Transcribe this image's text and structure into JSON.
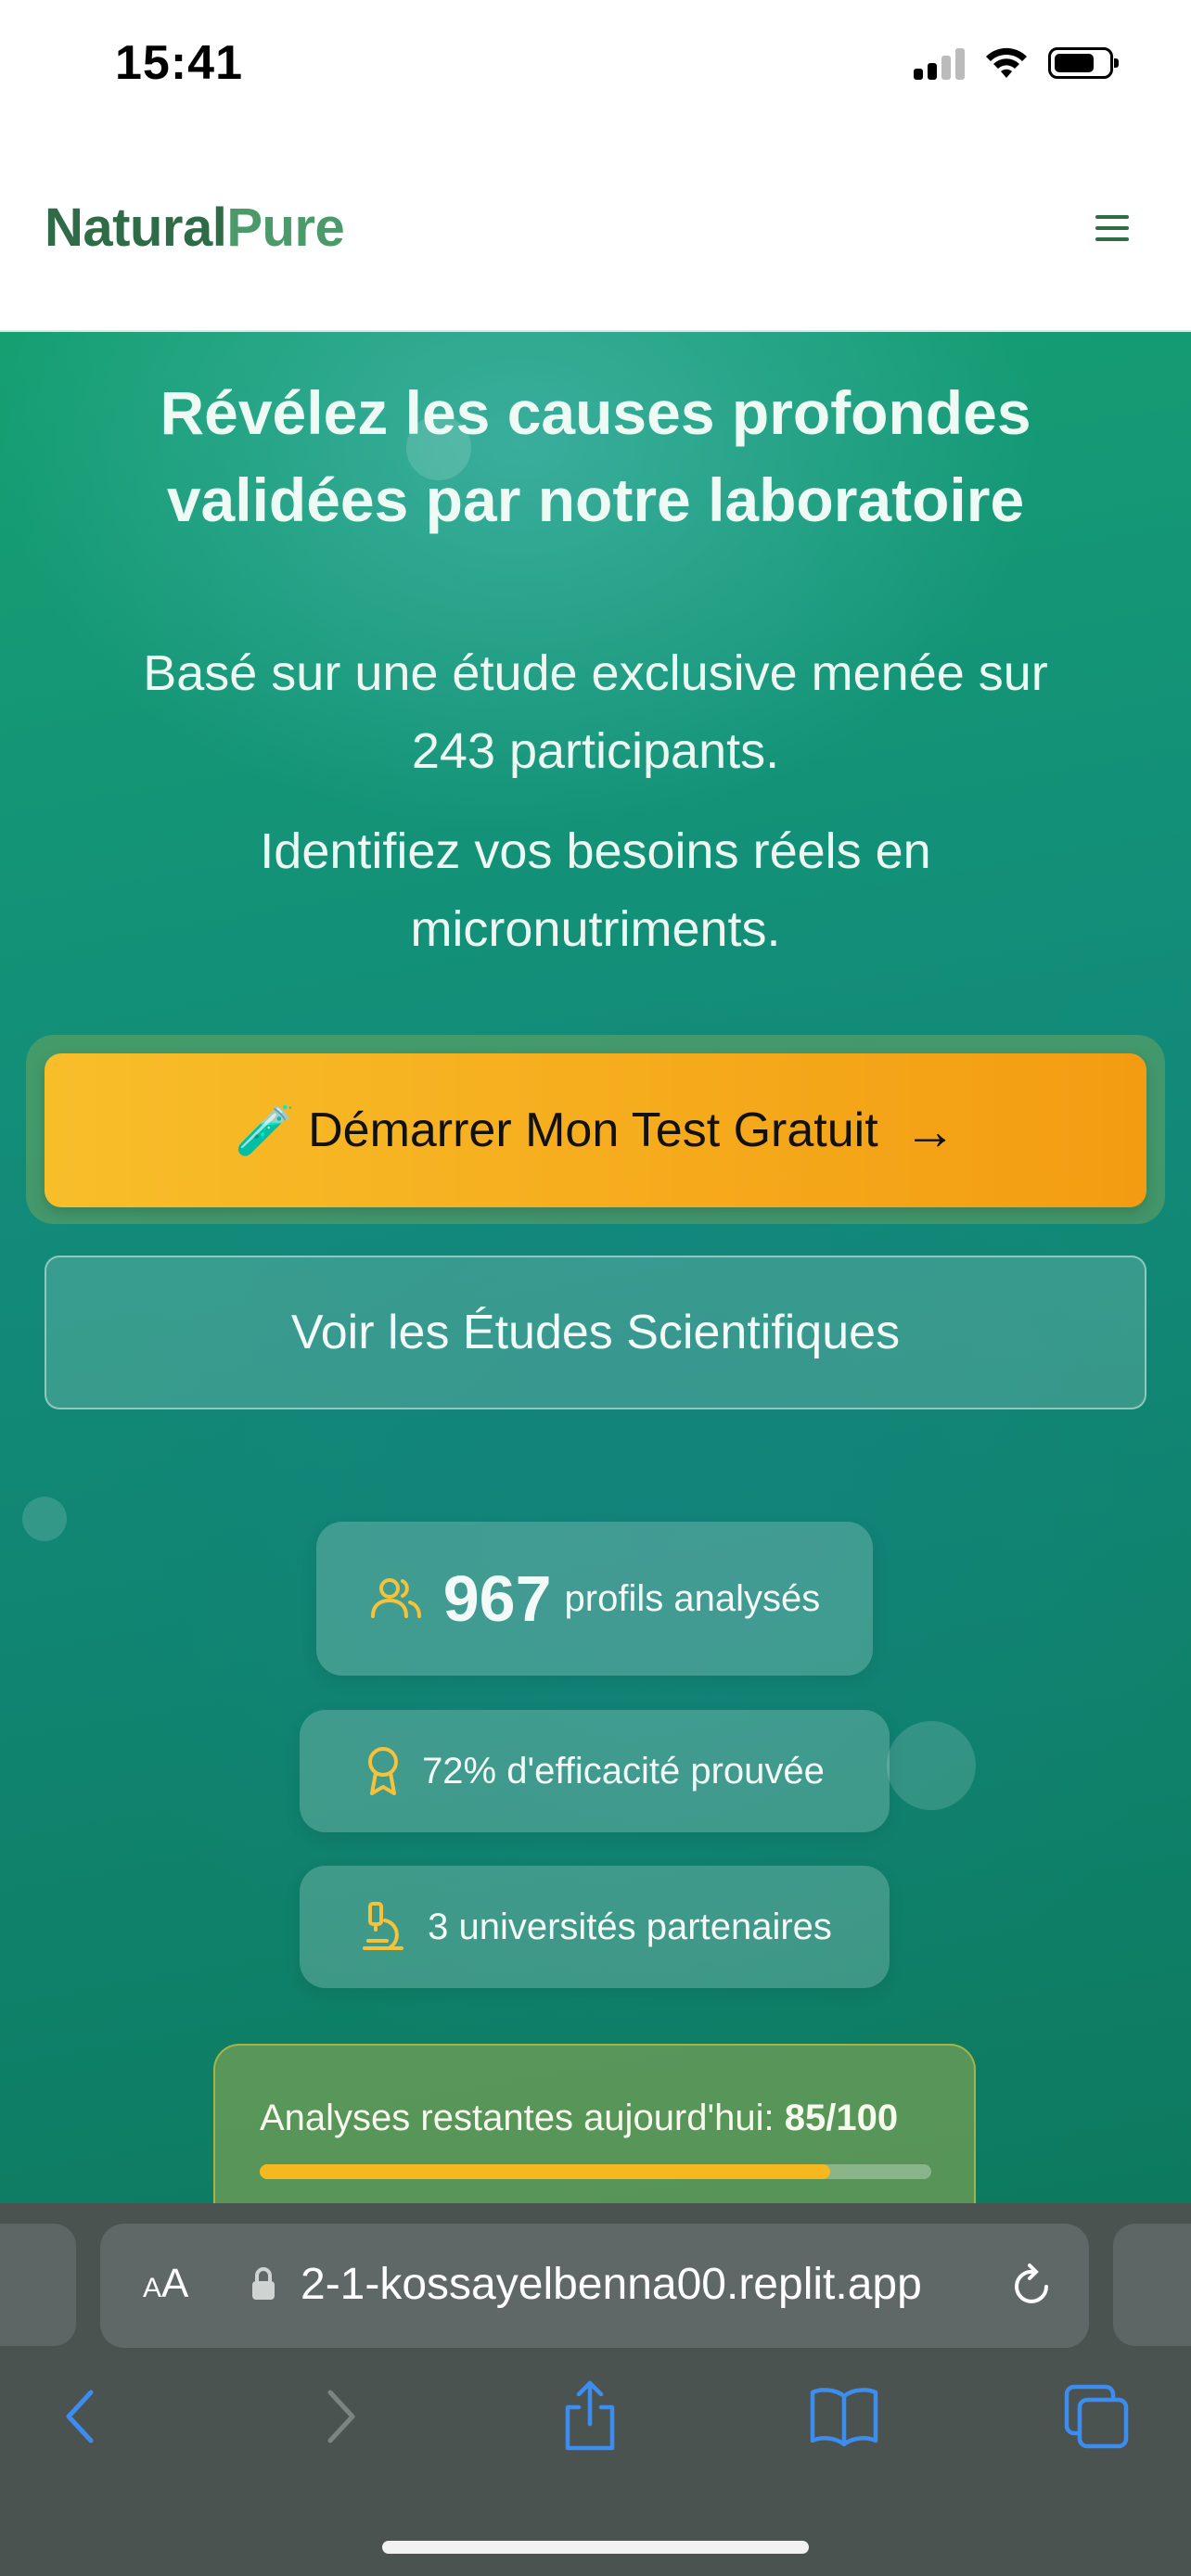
{
  "status": {
    "time": "15:41"
  },
  "header": {
    "logo_part1": "Natural",
    "logo_part2": "Pure"
  },
  "hero": {
    "title_line1": "Révélez les causes profondes",
    "title_line2": "validées par notre laboratoire",
    "sub1_line1": "Basé sur une étude exclusive menée sur",
    "sub1_line2": "243 participants.",
    "sub2_line1": "Identifiez vos besoins réels en",
    "sub2_line2": "micronutriments.",
    "cta_icon": "🧪",
    "cta_label": "Démarrer Mon Test Gratuit",
    "cta_arrow": "→",
    "secondary_label": "Voir les Études Scientifiques"
  },
  "stats": {
    "profiles_count": "967",
    "profiles_label": "profils analysés",
    "efficacy_label": "72% d'efficacité prouvée",
    "universities_label": "3 universités partenaires"
  },
  "progress": {
    "label": "Analyses restantes aujourd'hui:",
    "value_text": "85/100",
    "fraction": 0.85
  },
  "browser": {
    "aa_label_small": "A",
    "aa_label_big": "A",
    "url": "2-1-kossayelbenna00.replit.app"
  },
  "colors": {
    "accent": "#f5b81e",
    "brand_dark": "#2f6b47",
    "brand_light": "#4c9a6a",
    "hero_green": "#16a072"
  }
}
